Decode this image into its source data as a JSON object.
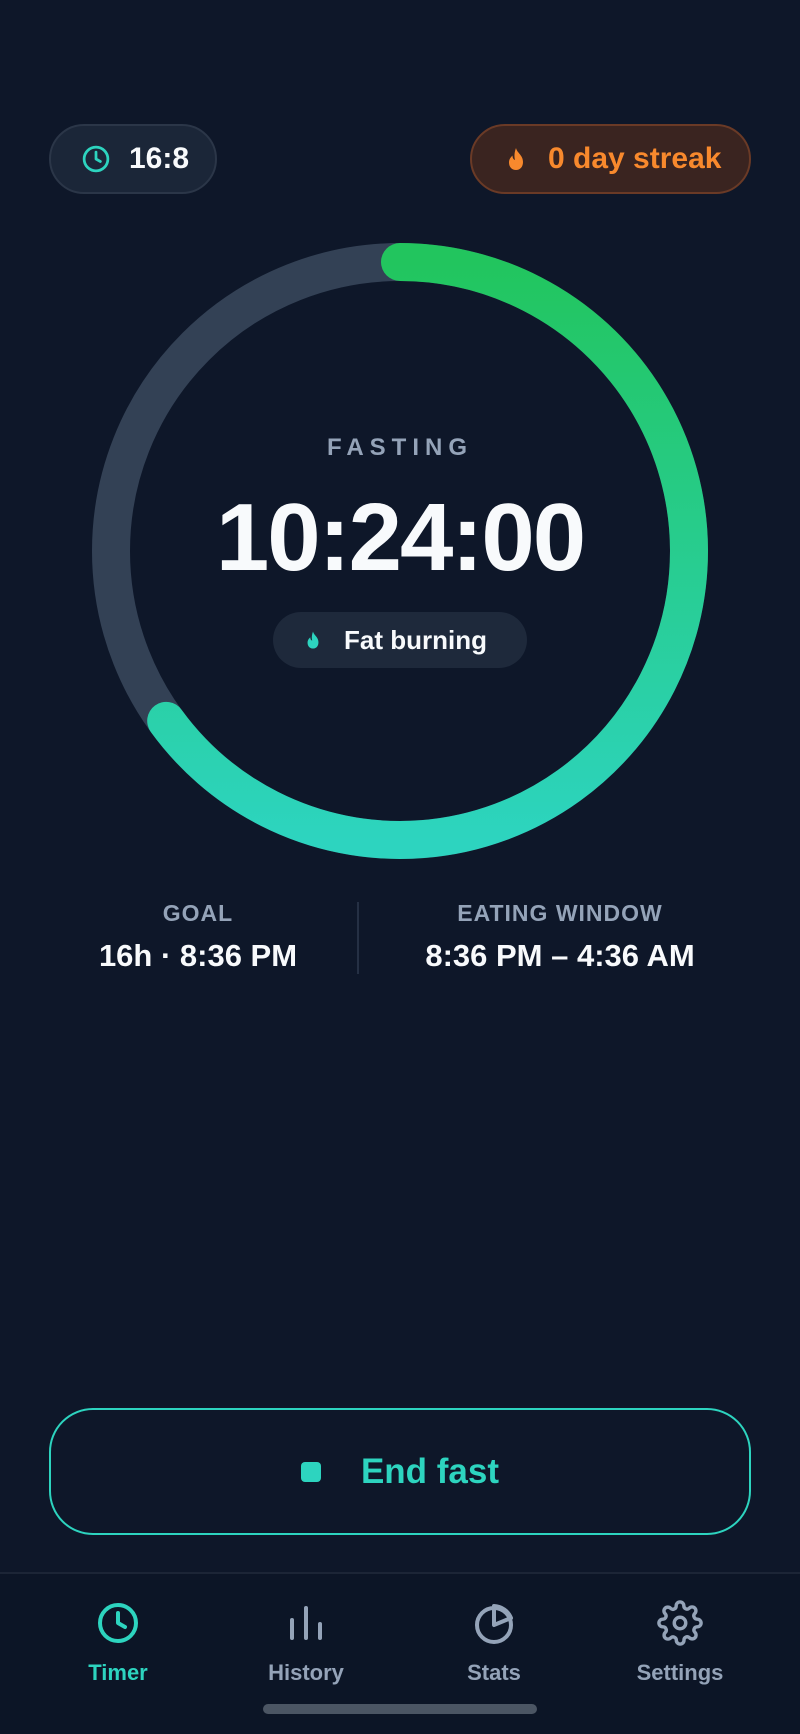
{
  "plan_chip": {
    "label": "16:8",
    "icon": "clock-icon"
  },
  "streak_chip": {
    "label": "0 day streak",
    "icon": "flame-icon"
  },
  "timer": {
    "status_label": "FASTING",
    "elapsed": "10:24:00",
    "phase_label": "Fat burning",
    "phase_icon": "flame-icon",
    "progress_fraction": 0.65
  },
  "goal": {
    "label": "GOAL",
    "value": "16h · 8:36 PM"
  },
  "eating_window": {
    "label": "EATING WINDOW",
    "value": "8:36 PM – 4:36 AM"
  },
  "end_button": {
    "label": "End fast",
    "icon": "stop-icon"
  },
  "nav": {
    "items": [
      {
        "label": "Timer",
        "icon": "clock-icon",
        "active": true
      },
      {
        "label": "History",
        "icon": "bar-chart-icon",
        "active": false
      },
      {
        "label": "Stats",
        "icon": "pie-chart-icon",
        "active": false
      },
      {
        "label": "Settings",
        "icon": "gear-icon",
        "active": false
      }
    ]
  },
  "colors": {
    "background": "#0e1729",
    "accent": "#2dd4bf",
    "progress_start": "#22c55e",
    "progress_end": "#2dd4bf",
    "track": "#334155",
    "streak": "#f8892d"
  }
}
